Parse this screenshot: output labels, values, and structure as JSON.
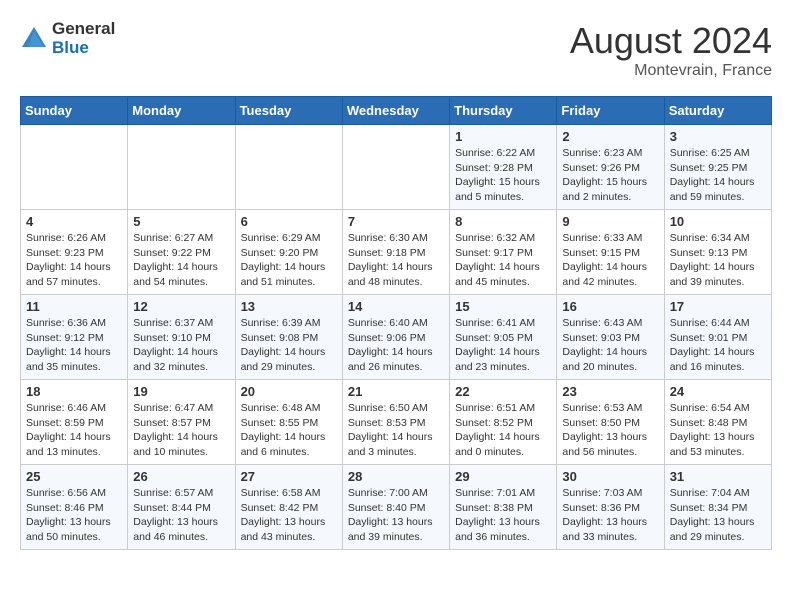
{
  "header": {
    "logo_general": "General",
    "logo_blue": "Blue",
    "month_year": "August 2024",
    "location": "Montevrain, France"
  },
  "days_of_week": [
    "Sunday",
    "Monday",
    "Tuesday",
    "Wednesday",
    "Thursday",
    "Friday",
    "Saturday"
  ],
  "weeks": [
    [
      {
        "day": "",
        "info": ""
      },
      {
        "day": "",
        "info": ""
      },
      {
        "day": "",
        "info": ""
      },
      {
        "day": "",
        "info": ""
      },
      {
        "day": "1",
        "info": "Sunrise: 6:22 AM\nSunset: 9:28 PM\nDaylight: 15 hours and 5 minutes."
      },
      {
        "day": "2",
        "info": "Sunrise: 6:23 AM\nSunset: 9:26 PM\nDaylight: 15 hours and 2 minutes."
      },
      {
        "day": "3",
        "info": "Sunrise: 6:25 AM\nSunset: 9:25 PM\nDaylight: 14 hours and 59 minutes."
      }
    ],
    [
      {
        "day": "4",
        "info": "Sunrise: 6:26 AM\nSunset: 9:23 PM\nDaylight: 14 hours and 57 minutes."
      },
      {
        "day": "5",
        "info": "Sunrise: 6:27 AM\nSunset: 9:22 PM\nDaylight: 14 hours and 54 minutes."
      },
      {
        "day": "6",
        "info": "Sunrise: 6:29 AM\nSunset: 9:20 PM\nDaylight: 14 hours and 51 minutes."
      },
      {
        "day": "7",
        "info": "Sunrise: 6:30 AM\nSunset: 9:18 PM\nDaylight: 14 hours and 48 minutes."
      },
      {
        "day": "8",
        "info": "Sunrise: 6:32 AM\nSunset: 9:17 PM\nDaylight: 14 hours and 45 minutes."
      },
      {
        "day": "9",
        "info": "Sunrise: 6:33 AM\nSunset: 9:15 PM\nDaylight: 14 hours and 42 minutes."
      },
      {
        "day": "10",
        "info": "Sunrise: 6:34 AM\nSunset: 9:13 PM\nDaylight: 14 hours and 39 minutes."
      }
    ],
    [
      {
        "day": "11",
        "info": "Sunrise: 6:36 AM\nSunset: 9:12 PM\nDaylight: 14 hours and 35 minutes."
      },
      {
        "day": "12",
        "info": "Sunrise: 6:37 AM\nSunset: 9:10 PM\nDaylight: 14 hours and 32 minutes."
      },
      {
        "day": "13",
        "info": "Sunrise: 6:39 AM\nSunset: 9:08 PM\nDaylight: 14 hours and 29 minutes."
      },
      {
        "day": "14",
        "info": "Sunrise: 6:40 AM\nSunset: 9:06 PM\nDaylight: 14 hours and 26 minutes."
      },
      {
        "day": "15",
        "info": "Sunrise: 6:41 AM\nSunset: 9:05 PM\nDaylight: 14 hours and 23 minutes."
      },
      {
        "day": "16",
        "info": "Sunrise: 6:43 AM\nSunset: 9:03 PM\nDaylight: 14 hours and 20 minutes."
      },
      {
        "day": "17",
        "info": "Sunrise: 6:44 AM\nSunset: 9:01 PM\nDaylight: 14 hours and 16 minutes."
      }
    ],
    [
      {
        "day": "18",
        "info": "Sunrise: 6:46 AM\nSunset: 8:59 PM\nDaylight: 14 hours and 13 minutes."
      },
      {
        "day": "19",
        "info": "Sunrise: 6:47 AM\nSunset: 8:57 PM\nDaylight: 14 hours and 10 minutes."
      },
      {
        "day": "20",
        "info": "Sunrise: 6:48 AM\nSunset: 8:55 PM\nDaylight: 14 hours and 6 minutes."
      },
      {
        "day": "21",
        "info": "Sunrise: 6:50 AM\nSunset: 8:53 PM\nDaylight: 14 hours and 3 minutes."
      },
      {
        "day": "22",
        "info": "Sunrise: 6:51 AM\nSunset: 8:52 PM\nDaylight: 14 hours and 0 minutes."
      },
      {
        "day": "23",
        "info": "Sunrise: 6:53 AM\nSunset: 8:50 PM\nDaylight: 13 hours and 56 minutes."
      },
      {
        "day": "24",
        "info": "Sunrise: 6:54 AM\nSunset: 8:48 PM\nDaylight: 13 hours and 53 minutes."
      }
    ],
    [
      {
        "day": "25",
        "info": "Sunrise: 6:56 AM\nSunset: 8:46 PM\nDaylight: 13 hours and 50 minutes."
      },
      {
        "day": "26",
        "info": "Sunrise: 6:57 AM\nSunset: 8:44 PM\nDaylight: 13 hours and 46 minutes."
      },
      {
        "day": "27",
        "info": "Sunrise: 6:58 AM\nSunset: 8:42 PM\nDaylight: 13 hours and 43 minutes."
      },
      {
        "day": "28",
        "info": "Sunrise: 7:00 AM\nSunset: 8:40 PM\nDaylight: 13 hours and 39 minutes."
      },
      {
        "day": "29",
        "info": "Sunrise: 7:01 AM\nSunset: 8:38 PM\nDaylight: 13 hours and 36 minutes."
      },
      {
        "day": "30",
        "info": "Sunrise: 7:03 AM\nSunset: 8:36 PM\nDaylight: 13 hours and 33 minutes."
      },
      {
        "day": "31",
        "info": "Sunrise: 7:04 AM\nSunset: 8:34 PM\nDaylight: 13 hours and 29 minutes."
      }
    ]
  ]
}
